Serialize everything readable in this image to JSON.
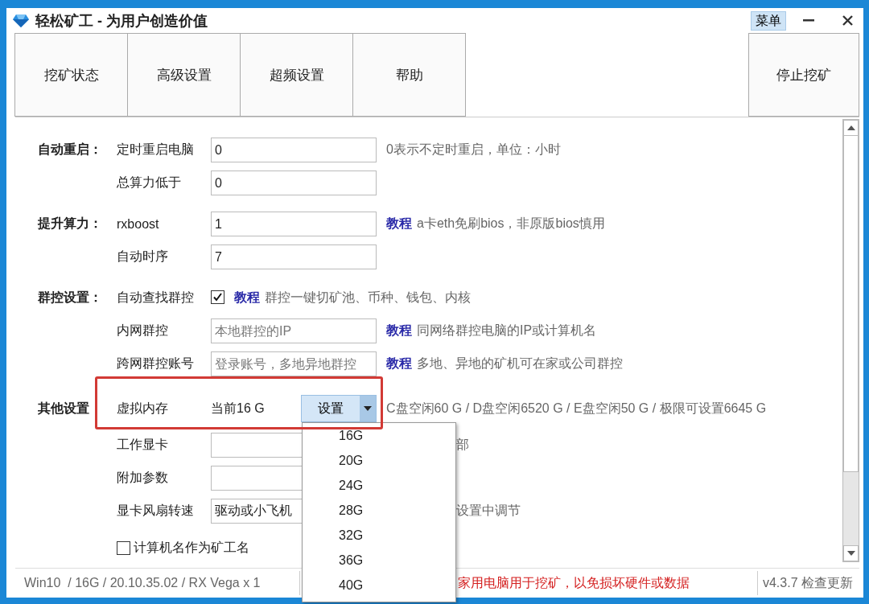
{
  "window": {
    "title": "轻松矿工 - 为用户创造价值",
    "menu_button": "菜单"
  },
  "nav_buttons": [
    "挖矿状态",
    "高级设置",
    "超频设置",
    "帮助"
  ],
  "stop_button": "停止挖矿",
  "sections": [
    {
      "heading": "自动重启：",
      "rows": [
        {
          "kind": "input",
          "label": "定时重启电脑",
          "value": "0",
          "hint": "0表示不定时重启，单位：小时"
        },
        {
          "kind": "input",
          "label": "总算力低于",
          "value": "0"
        }
      ]
    },
    {
      "heading": "提升算力：",
      "rows": [
        {
          "kind": "input",
          "label": "rxboost",
          "value": "1",
          "link": "教程",
          "hint": "a卡eth免刷bios，非原版bios慎用"
        },
        {
          "kind": "input",
          "label": "自动时序",
          "value": "7"
        }
      ]
    },
    {
      "heading": "群控设置：",
      "rows": [
        {
          "kind": "checkbox",
          "label": "自动查找群控",
          "checked": true,
          "link": "教程",
          "hint": "群控一键切矿池、币种、钱包、内核"
        },
        {
          "kind": "input",
          "label": "内网群控",
          "placeholder": "本地群控的IP",
          "link": "教程",
          "hint": "同网络群控电脑的IP或计算机名"
        },
        {
          "kind": "input",
          "label": "跨网群控账号",
          "placeholder": "登录账号，多地异地群控",
          "link": "教程",
          "hint": "多地、异地的矿机可在家或公司群控"
        }
      ]
    },
    {
      "heading": "其他设置",
      "rows": [
        {
          "kind": "dropdown",
          "label": "虚拟内存",
          "current": "当前16 G",
          "button": "设置",
          "expanded": true,
          "options": [
            "16G",
            "20G",
            "24G",
            "28G",
            "32G",
            "36G",
            "40G"
          ],
          "hint": "C盘空闲60 G / D盘空闲6520 G / E盘空闲50 G / 极限可设置6645 G"
        },
        {
          "kind": "input",
          "label": "工作显卡",
          "hint": "部"
        },
        {
          "kind": "input",
          "label": "附加参数"
        },
        {
          "kind": "input",
          "label": "显卡风扇转速",
          "value": "驱动或小飞机",
          "hint": "设置中调节"
        },
        {
          "kind": "check_only",
          "label": "计算机名作为矿工名",
          "checked": false
        }
      ]
    }
  ],
  "status_bar": {
    "system_info": "Win10  / 16G / 20.10.35.02 / RX Vega x 1",
    "warning": "家用电脑用于挖矿，以免损坏硬件或数据",
    "version": "v4.3.7 检查更新"
  }
}
